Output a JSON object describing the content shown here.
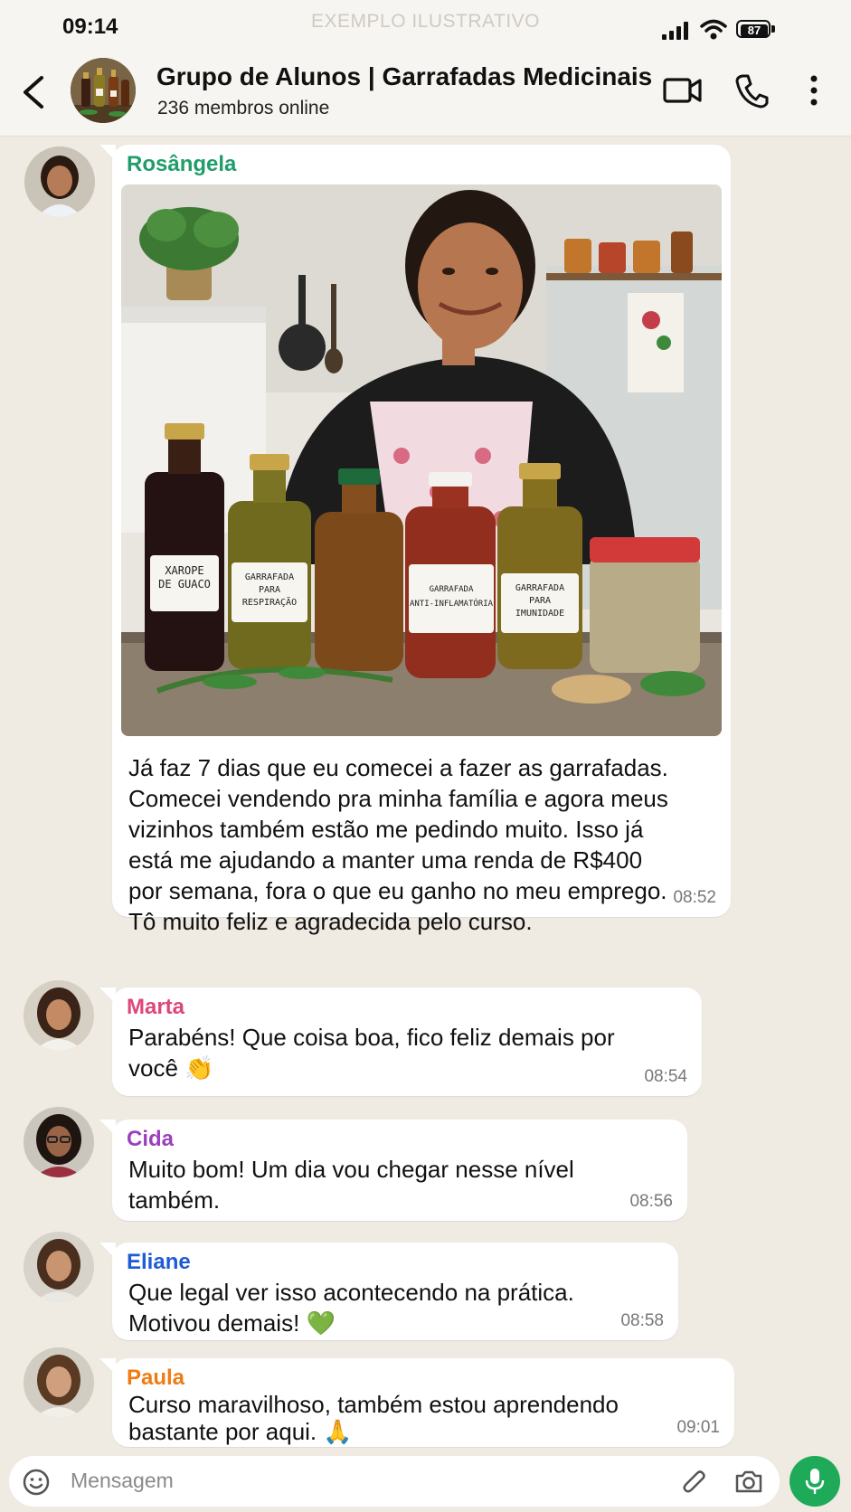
{
  "status": {
    "time": "09:14",
    "watermark": "EXEMPLO ILUSTRATIVO",
    "battery": "87"
  },
  "header": {
    "title": "Grupo de Alunos | Garrafadas Medicinais",
    "subtitle": "236 membros online"
  },
  "messages": [
    {
      "sender": "Rosângela",
      "sender_color": "#1f9d6a",
      "text": "Já faz 7 dias que eu comecei a fazer as garrafadas.\nComecei vendendo pra minha família e agora meus\nvizinhos também estão me pedindo muito. Isso já\nestá me ajudando a manter uma renda de R$400\npor semana, fora o que eu ganho no meu emprego.\nTô muito feliz e agradecida pelo curso.",
      "time": "08:52",
      "photo_labels": [
        "XAROPE\nDE GUACO",
        "GARRAFADA\nPARA\nRESPIRAÇÃO",
        "GARRAFADA\nANTI-INFLAMATÓRIA",
        "GARRAFADA\nPARA\nIMUNIDADE"
      ]
    },
    {
      "sender": "Marta",
      "sender_color": "#e0457b",
      "text": "Parabéns! Que coisa boa, fico feliz demais por\nvocê 👏",
      "time": "08:54"
    },
    {
      "sender": "Cida",
      "sender_color": "#9c3fbf",
      "text": "Muito bom! Um dia vou chegar nesse nível\ntambém.",
      "time": "08:56"
    },
    {
      "sender": "Eliane",
      "sender_color": "#1e5bd6",
      "text": "Que legal ver isso acontecendo na prática.\nMotivou demais! 💚",
      "time": "08:58"
    },
    {
      "sender": "Paula",
      "sender_color": "#f07b12",
      "text": "Curso maravilhoso, também estou aprendendo\nbastante por aqui. 🙏",
      "time": "09:01"
    }
  ],
  "input": {
    "placeholder": "Mensagem"
  },
  "icons": [
    "back-arrow-icon",
    "video-call-icon",
    "phone-icon",
    "more-vert-icon",
    "emoji-icon",
    "attach-icon",
    "camera-icon",
    "mic-icon"
  ],
  "colors": {
    "accent": "#1faa59",
    "background": "#efeae2"
  }
}
